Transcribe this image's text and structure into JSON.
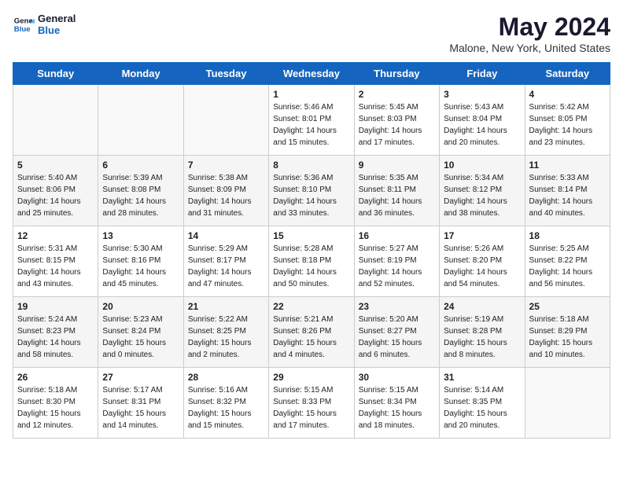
{
  "logo": {
    "line1": "General",
    "line2": "Blue"
  },
  "title": "May 2024",
  "subtitle": "Malone, New York, United States",
  "weekdays": [
    "Sunday",
    "Monday",
    "Tuesday",
    "Wednesday",
    "Thursday",
    "Friday",
    "Saturday"
  ],
  "weeks": [
    [
      {
        "day": "",
        "sunrise": "",
        "sunset": "",
        "daylight": ""
      },
      {
        "day": "",
        "sunrise": "",
        "sunset": "",
        "daylight": ""
      },
      {
        "day": "",
        "sunrise": "",
        "sunset": "",
        "daylight": ""
      },
      {
        "day": "1",
        "sunrise": "Sunrise: 5:46 AM",
        "sunset": "Sunset: 8:01 PM",
        "daylight": "Daylight: 14 hours and 15 minutes."
      },
      {
        "day": "2",
        "sunrise": "Sunrise: 5:45 AM",
        "sunset": "Sunset: 8:03 PM",
        "daylight": "Daylight: 14 hours and 17 minutes."
      },
      {
        "day": "3",
        "sunrise": "Sunrise: 5:43 AM",
        "sunset": "Sunset: 8:04 PM",
        "daylight": "Daylight: 14 hours and 20 minutes."
      },
      {
        "day": "4",
        "sunrise": "Sunrise: 5:42 AM",
        "sunset": "Sunset: 8:05 PM",
        "daylight": "Daylight: 14 hours and 23 minutes."
      }
    ],
    [
      {
        "day": "5",
        "sunrise": "Sunrise: 5:40 AM",
        "sunset": "Sunset: 8:06 PM",
        "daylight": "Daylight: 14 hours and 25 minutes."
      },
      {
        "day": "6",
        "sunrise": "Sunrise: 5:39 AM",
        "sunset": "Sunset: 8:08 PM",
        "daylight": "Daylight: 14 hours and 28 minutes."
      },
      {
        "day": "7",
        "sunrise": "Sunrise: 5:38 AM",
        "sunset": "Sunset: 8:09 PM",
        "daylight": "Daylight: 14 hours and 31 minutes."
      },
      {
        "day": "8",
        "sunrise": "Sunrise: 5:36 AM",
        "sunset": "Sunset: 8:10 PM",
        "daylight": "Daylight: 14 hours and 33 minutes."
      },
      {
        "day": "9",
        "sunrise": "Sunrise: 5:35 AM",
        "sunset": "Sunset: 8:11 PM",
        "daylight": "Daylight: 14 hours and 36 minutes."
      },
      {
        "day": "10",
        "sunrise": "Sunrise: 5:34 AM",
        "sunset": "Sunset: 8:12 PM",
        "daylight": "Daylight: 14 hours and 38 minutes."
      },
      {
        "day": "11",
        "sunrise": "Sunrise: 5:33 AM",
        "sunset": "Sunset: 8:14 PM",
        "daylight": "Daylight: 14 hours and 40 minutes."
      }
    ],
    [
      {
        "day": "12",
        "sunrise": "Sunrise: 5:31 AM",
        "sunset": "Sunset: 8:15 PM",
        "daylight": "Daylight: 14 hours and 43 minutes."
      },
      {
        "day": "13",
        "sunrise": "Sunrise: 5:30 AM",
        "sunset": "Sunset: 8:16 PM",
        "daylight": "Daylight: 14 hours and 45 minutes."
      },
      {
        "day": "14",
        "sunrise": "Sunrise: 5:29 AM",
        "sunset": "Sunset: 8:17 PM",
        "daylight": "Daylight: 14 hours and 47 minutes."
      },
      {
        "day": "15",
        "sunrise": "Sunrise: 5:28 AM",
        "sunset": "Sunset: 8:18 PM",
        "daylight": "Daylight: 14 hours and 50 minutes."
      },
      {
        "day": "16",
        "sunrise": "Sunrise: 5:27 AM",
        "sunset": "Sunset: 8:19 PM",
        "daylight": "Daylight: 14 hours and 52 minutes."
      },
      {
        "day": "17",
        "sunrise": "Sunrise: 5:26 AM",
        "sunset": "Sunset: 8:20 PM",
        "daylight": "Daylight: 14 hours and 54 minutes."
      },
      {
        "day": "18",
        "sunrise": "Sunrise: 5:25 AM",
        "sunset": "Sunset: 8:22 PM",
        "daylight": "Daylight: 14 hours and 56 minutes."
      }
    ],
    [
      {
        "day": "19",
        "sunrise": "Sunrise: 5:24 AM",
        "sunset": "Sunset: 8:23 PM",
        "daylight": "Daylight: 14 hours and 58 minutes."
      },
      {
        "day": "20",
        "sunrise": "Sunrise: 5:23 AM",
        "sunset": "Sunset: 8:24 PM",
        "daylight": "Daylight: 15 hours and 0 minutes."
      },
      {
        "day": "21",
        "sunrise": "Sunrise: 5:22 AM",
        "sunset": "Sunset: 8:25 PM",
        "daylight": "Daylight: 15 hours and 2 minutes."
      },
      {
        "day": "22",
        "sunrise": "Sunrise: 5:21 AM",
        "sunset": "Sunset: 8:26 PM",
        "daylight": "Daylight: 15 hours and 4 minutes."
      },
      {
        "day": "23",
        "sunrise": "Sunrise: 5:20 AM",
        "sunset": "Sunset: 8:27 PM",
        "daylight": "Daylight: 15 hours and 6 minutes."
      },
      {
        "day": "24",
        "sunrise": "Sunrise: 5:19 AM",
        "sunset": "Sunset: 8:28 PM",
        "daylight": "Daylight: 15 hours and 8 minutes."
      },
      {
        "day": "25",
        "sunrise": "Sunrise: 5:18 AM",
        "sunset": "Sunset: 8:29 PM",
        "daylight": "Daylight: 15 hours and 10 minutes."
      }
    ],
    [
      {
        "day": "26",
        "sunrise": "Sunrise: 5:18 AM",
        "sunset": "Sunset: 8:30 PM",
        "daylight": "Daylight: 15 hours and 12 minutes."
      },
      {
        "day": "27",
        "sunrise": "Sunrise: 5:17 AM",
        "sunset": "Sunset: 8:31 PM",
        "daylight": "Daylight: 15 hours and 14 minutes."
      },
      {
        "day": "28",
        "sunrise": "Sunrise: 5:16 AM",
        "sunset": "Sunset: 8:32 PM",
        "daylight": "Daylight: 15 hours and 15 minutes."
      },
      {
        "day": "29",
        "sunrise": "Sunrise: 5:15 AM",
        "sunset": "Sunset: 8:33 PM",
        "daylight": "Daylight: 15 hours and 17 minutes."
      },
      {
        "day": "30",
        "sunrise": "Sunrise: 5:15 AM",
        "sunset": "Sunset: 8:34 PM",
        "daylight": "Daylight: 15 hours and 18 minutes."
      },
      {
        "day": "31",
        "sunrise": "Sunrise: 5:14 AM",
        "sunset": "Sunset: 8:35 PM",
        "daylight": "Daylight: 15 hours and 20 minutes."
      },
      {
        "day": "",
        "sunrise": "",
        "sunset": "",
        "daylight": ""
      }
    ]
  ]
}
